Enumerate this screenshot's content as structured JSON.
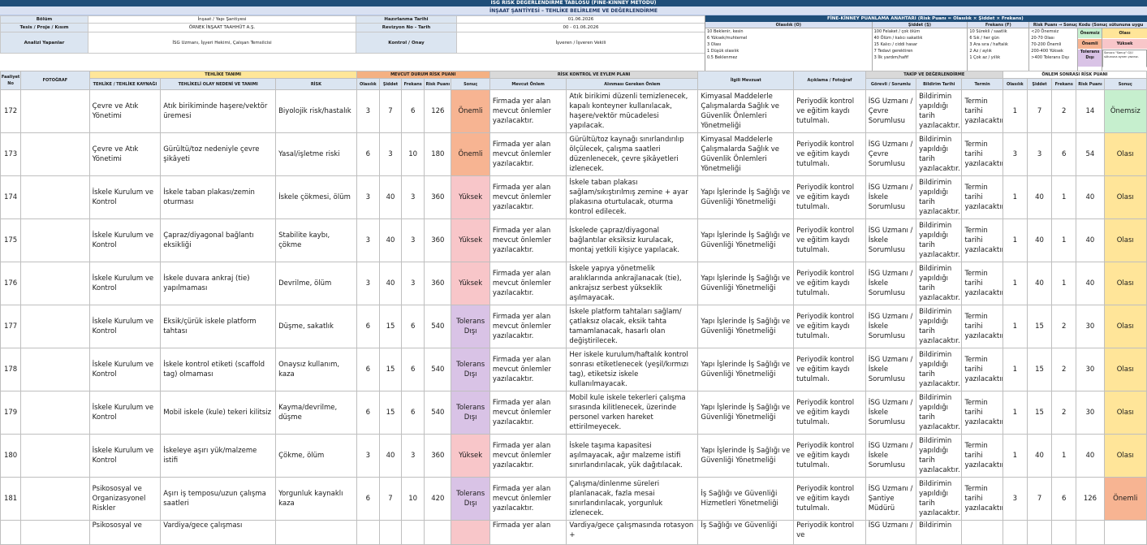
{
  "title": "İSG RİSK DEĞERLENDİRME TABLOSU (FİNE-KİNNEY METODU)",
  "subtitle": "İNŞAAT ŞANTİYESİ – TEHLİKE BELİRLEME VE DEĞERLENDİRME",
  "meta": {
    "bolum_label": "Bölüm",
    "bolum_value": "İnşaat / Yapı Şantiyesi",
    "tesis_label": "Tesis / Proje / Kısım",
    "tesis_value": "ÖRNEK İNŞAAT TAAHHÜT A.Ş.",
    "analiz_label": "Analizi Yapanlar",
    "analiz_value": "İSG Uzmanı, İşyeri Hekimi, Çalışan Temsilcisi",
    "hazirlanma_label": "Hazırlanma Tarihi",
    "hazirlanma_value": "01.06.2026",
    "revizyon_label": "Revizyon No - Tarih",
    "revizyon_value": "00 - 01.06.2026",
    "kontrol_label": "Kontrol / Onay",
    "kontrol_value": "İşveren / İşveren Vekili"
  },
  "legend": {
    "title": "FİNE-KİNNEY PUANLAMA ANAHTARI  (Risk Puanı = Olasılık × Şiddet × Frekans)",
    "h_olasilik": "Olasılık (O)",
    "h_siddet": "Şiddet (Ş)",
    "h_frekans": "Frekans (F)",
    "h_sonuc": "Risk Puanı → Sonuç Kodu (Sonuç sütununa uygu",
    "olasilik": [
      "10  Beklenir, kesin",
      "6  Yüksek/muhtemel",
      "3  Olası",
      "1  Düşük olasılık",
      "0.5  Beklenmez"
    ],
    "siddet": [
      "100  Felaket / çok ölüm",
      "40  Ölüm / kalıcı sakatlık",
      "15  Kalıcı / ciddi hasar",
      "7  Tedavi gerektiren",
      "3  İlk yardım/hafif"
    ],
    "frekans": [
      "10  Sürekli / saatlik",
      "6  Sık / her gün",
      "3  Ara sıra / haftalık",
      "2  Az / aylık",
      "1  Çok az / yıllık"
    ],
    "sonuc": [
      "<20  Önemsiz",
      "20-70  Olası",
      "70-200  Önemli",
      "200-400  Yüksek",
      ">400  Tolerans Dışı"
    ],
    "codes": [
      "Önemsiz",
      "Önemli",
      "Tolerans Dışı"
    ],
    "codes2": [
      "Olası",
      "Yüksek"
    ],
    "note": "Sonucu \"Sonuç\" G/U sütununa aynen yazınız."
  },
  "headers": {
    "g_faaliyet": "Faaliyet No",
    "g_foto": "FOTOĞRAF",
    "g_tanim": "TEHLİKE TANIMI",
    "g_mevcut": "MEVCUT DURUM RİSK PUANI",
    "g_kontrol": "RİSK KONTROL VE EYLEM PLANI",
    "g_takip": "TAKİP VE DEĞERLENDİRME",
    "g_sonra": "ÖNLEM SONRASI RİSK PUANI",
    "kaynak": "TEHLİKE / TEHLİKE KAYNAĞI",
    "olay": "TEHLİKELİ OLAY NEDENİ VE TANIMI",
    "risk": "RİSK",
    "olasilik": "Olasılık",
    "siddet": "Şiddet",
    "frekans": "Frekans",
    "puan": "Risk Puanı",
    "sonuc": "Sonuç",
    "mevcut_onlem": "Mevcut Önlem",
    "alinmasi": "Alınması Gereken Önlem",
    "mevzuat": "İlgili Mevzuat",
    "aciklama": "Açıklama / Fotoğraf",
    "gorevli": "Görevli / Sorumlu",
    "bildirim": "Bildirim Tarihi",
    "termin": "Termin",
    "olasilik2": "Olasılık",
    "siddet2": "Şiddet",
    "frekans2": "Frekans",
    "puan2": "Risk Puanı",
    "sonuc2": "Sonuç"
  },
  "rows": [
    {
      "no": "172",
      "kaynak": "Çevre ve Atık Yönetimi",
      "olay": "Atık birikiminde haşere/vektör üremesi",
      "risk": "Biyolojik risk/hastalık",
      "o": "3",
      "s": "7",
      "f": "6",
      "p": "126",
      "sonuc": "Önemli",
      "mevcut": "Firmada yer alan mevcut önlemler yazılacaktır.",
      "alinmasi": "Atık birikimi düzenli temizlenecek, kapalı konteyner kullanılacak, haşere/vektör mücadelesi yapılacak.",
      "mevzuat": "Kimyasal Maddelerle Çalışmalarda Sağlık ve Güvenlik Önlemleri Yönetmeliği",
      "aciklama": "Periyodik kontrol ve eğitim kaydı tutulmalı.",
      "gorevli": "İSG Uzmanı / Çevre Sorumlusu",
      "bildirim": "Bildirimin yapıldığı tarih yazılacaktır.",
      "termin": "Termin tarihi yazılacaktır.",
      "o2": "1",
      "s2": "7",
      "f2": "2",
      "p2": "14",
      "sonuc2": "Önemsiz"
    },
    {
      "no": "173",
      "kaynak": "Çevre ve Atık Yönetimi",
      "olay": "Gürültü/toz nedeniyle çevre şikâyeti",
      "risk": "Yasal/işletme riski",
      "o": "6",
      "s": "3",
      "f": "10",
      "p": "180",
      "sonuc": "Önemli",
      "mevcut": "Firmada yer alan mevcut önlemler yazılacaktır.",
      "alinmasi": "Gürültü/toz kaynağı sınırlandırılıp ölçülecek, çalışma saatleri düzenlenecek, çevre şikâyetleri izlenecek.",
      "mevzuat": "Kimyasal Maddelerle Çalışmalarda Sağlık ve Güvenlik Önlemleri Yönetmeliği",
      "aciklama": "Periyodik kontrol ve eğitim kaydı tutulmalı.",
      "gorevli": "İSG Uzmanı / Çevre Sorumlusu",
      "bildirim": "Bildirimin yapıldığı tarih yazılacaktır.",
      "termin": "Termin tarihi yazılacaktır.",
      "o2": "3",
      "s2": "3",
      "f2": "6",
      "p2": "54",
      "sonuc2": "Olası"
    },
    {
      "no": "174",
      "kaynak": "İskele Kurulum ve Kontrol",
      "olay": "İskele taban plakası/zemin oturması",
      "risk": "İskele çökmesi, ölüm",
      "o": "3",
      "s": "40",
      "f": "3",
      "p": "360",
      "sonuc": "Yüksek",
      "mevcut": "Firmada yer alan mevcut önlemler yazılacaktır.",
      "alinmasi": "İskele taban plakası sağlam/sıkıştırılmış zemine + ayar plakasına oturtulacak, oturma kontrol edilecek.",
      "mevzuat": "Yapı İşlerinde İş Sağlığı ve Güvenliği Yönetmeliği",
      "aciklama": "Periyodik kontrol ve eğitim kaydı tutulmalı.",
      "gorevli": "İSG Uzmanı / İskele Sorumlusu",
      "bildirim": "Bildirimin yapıldığı tarih yazılacaktır.",
      "termin": "Termin tarihi yazılacaktır.",
      "o2": "1",
      "s2": "40",
      "f2": "1",
      "p2": "40",
      "sonuc2": "Olası"
    },
    {
      "no": "175",
      "kaynak": "İskele Kurulum ve Kontrol",
      "olay": "Çapraz/diyagonal bağlantı eksikliği",
      "risk": "Stabilite kaybı, çökme",
      "o": "3",
      "s": "40",
      "f": "3",
      "p": "360",
      "sonuc": "Yüksek",
      "mevcut": "Firmada yer alan mevcut önlemler yazılacaktır.",
      "alinmasi": "İskelede çapraz/diyagonal bağlantılar eksiksiz kurulacak, montaj yetkili kişiyce yapılacak.",
      "mevzuat": "Yapı İşlerinde İş Sağlığı ve Güvenliği Yönetmeliği",
      "aciklama": "Periyodik kontrol ve eğitim kaydı tutulmalı.",
      "gorevli": "İSG Uzmanı / İskele Sorumlusu",
      "bildirim": "Bildirimin yapıldığı tarih yazılacaktır.",
      "termin": "Termin tarihi yazılacaktır.",
      "o2": "1",
      "s2": "40",
      "f2": "1",
      "p2": "40",
      "sonuc2": "Olası"
    },
    {
      "no": "176",
      "kaynak": "İskele Kurulum ve Kontrol",
      "olay": "İskele duvara ankraj (tie) yapılmaması",
      "risk": "Devrilme, ölüm",
      "o": "3",
      "s": "40",
      "f": "3",
      "p": "360",
      "sonuc": "Yüksek",
      "mevcut": "Firmada yer alan mevcut önlemler yazılacaktır.",
      "alinmasi": "İskele yapıya yönetmelik aralıklarında ankrajlanacak (tie), ankrajsız serbest yükseklik aşılmayacak.",
      "mevzuat": "Yapı İşlerinde İş Sağlığı ve Güvenliği Yönetmeliği",
      "aciklama": "Periyodik kontrol ve eğitim kaydı tutulmalı.",
      "gorevli": "İSG Uzmanı / İskele Sorumlusu",
      "bildirim": "Bildirimin yapıldığı tarih yazılacaktır.",
      "termin": "Termin tarihi yazılacaktır.",
      "o2": "1",
      "s2": "40",
      "f2": "1",
      "p2": "40",
      "sonuc2": "Olası"
    },
    {
      "no": "177",
      "kaynak": "İskele Kurulum ve Kontrol",
      "olay": "Eksik/çürük iskele platform tahtası",
      "risk": "Düşme, sakatlık",
      "o": "6",
      "s": "15",
      "f": "6",
      "p": "540",
      "sonuc": "Tolerans Dışı",
      "mevcut": "Firmada yer alan mevcut önlemler yazılacaktır.",
      "alinmasi": "İskele platform tahtaları sağlam/çatlaksız olacak, eksik tahta tamamlanacak, hasarlı olan değiştirilecek.",
      "mevzuat": "Yapı İşlerinde İş Sağlığı ve Güvenliği Yönetmeliği",
      "aciklama": "Periyodik kontrol ve eğitim kaydı tutulmalı.",
      "gorevli": "İSG Uzmanı / İskele Sorumlusu",
      "bildirim": "Bildirimin yapıldığı tarih yazılacaktır.",
      "termin": "Termin tarihi yazılacaktır.",
      "o2": "1",
      "s2": "15",
      "f2": "2",
      "p2": "30",
      "sonuc2": "Olası"
    },
    {
      "no": "178",
      "kaynak": "İskele Kurulum ve Kontrol",
      "olay": "İskele kontrol etiketi (scaffold tag) olmaması",
      "risk": "Onaysız kullanım, kaza",
      "o": "6",
      "s": "15",
      "f": "6",
      "p": "540",
      "sonuc": "Tolerans Dışı",
      "mevcut": "Firmada yer alan mevcut önlemler yazılacaktır.",
      "alinmasi": "Her iskele kurulum/haftalık kontrol sonrası etiketlenecek (yeşil/kırmızı tag), etiketsiz iskele kullanılmayacak.",
      "mevzuat": "Yapı İşlerinde İş Sağlığı ve Güvenliği Yönetmeliği",
      "aciklama": "Periyodik kontrol ve eğitim kaydı tutulmalı.",
      "gorevli": "İSG Uzmanı / İskele Sorumlusu",
      "bildirim": "Bildirimin yapıldığı tarih yazılacaktır.",
      "termin": "Termin tarihi yazılacaktır.",
      "o2": "1",
      "s2": "15",
      "f2": "2",
      "p2": "30",
      "sonuc2": "Olası"
    },
    {
      "no": "179",
      "kaynak": "İskele Kurulum ve Kontrol",
      "olay": "Mobil iskele (kule) tekeri kilitsiz",
      "risk": "Kayma/devrilme, düşme",
      "o": "6",
      "s": "15",
      "f": "6",
      "p": "540",
      "sonuc": "Tolerans Dışı",
      "mevcut": "Firmada yer alan mevcut önlemler yazılacaktır.",
      "alinmasi": "Mobil kule iskele tekerleri çalışma sırasında kilitlenecek, üzerinde personel varken hareket ettirilmeyecek.",
      "mevzuat": "Yapı İşlerinde İş Sağlığı ve Güvenliği Yönetmeliği",
      "aciklama": "Periyodik kontrol ve eğitim kaydı tutulmalı.",
      "gorevli": "İSG Uzmanı / İskele Sorumlusu",
      "bildirim": "Bildirimin yapıldığı tarih yazılacaktır.",
      "termin": "Termin tarihi yazılacaktır.",
      "o2": "1",
      "s2": "15",
      "f2": "2",
      "p2": "30",
      "sonuc2": "Olası"
    },
    {
      "no": "180",
      "kaynak": "İskele Kurulum ve Kontrol",
      "olay": "İskeleye aşırı yük/malzeme istifi",
      "risk": "Çökme, ölüm",
      "o": "3",
      "s": "40",
      "f": "3",
      "p": "360",
      "sonuc": "Yüksek",
      "mevcut": "Firmada yer alan mevcut önlemler yazılacaktır.",
      "alinmasi": "İskele taşıma kapasitesi aşılmayacak, ağır malzeme istifi sınırlandırılacak, yük dağıtılacak.",
      "mevzuat": "Yapı İşlerinde İş Sağlığı ve Güvenliği Yönetmeliği",
      "aciklama": "Periyodik kontrol ve eğitim kaydı tutulmalı.",
      "gorevli": "İSG Uzmanı / İskele Sorumlusu",
      "bildirim": "Bildirimin yapıldığı tarih yazılacaktır.",
      "termin": "Termin tarihi yazılacaktır.",
      "o2": "1",
      "s2": "40",
      "f2": "1",
      "p2": "40",
      "sonuc2": "Olası"
    },
    {
      "no": "181",
      "kaynak": "Psikososyal ve Organizasyonel Riskler",
      "olay": "Aşırı iş temposu/uzun çalışma saatleri",
      "risk": "Yorgunluk kaynaklı kaza",
      "o": "6",
      "s": "7",
      "f": "10",
      "p": "420",
      "sonuc": "Tolerans Dışı",
      "mevcut": "Firmada yer alan mevcut önlemler yazılacaktır.",
      "alinmasi": "Çalışma/dinlenme süreleri planlanacak, fazla mesai sınırlandırılacak, yorgunluk izlenecek.",
      "mevzuat": "İş Sağlığı ve Güvenliği Hizmetleri Yönetmeliği",
      "aciklama": "Periyodik kontrol ve eğitim kaydı tutulmalı.",
      "gorevli": "İSG Uzmanı / Şantiye Müdürü",
      "bildirim": "Bildirimin yapıldığı tarih yazılacaktır.",
      "termin": "Termin tarihi yazılacaktır.",
      "o2": "3",
      "s2": "7",
      "f2": "6",
      "p2": "126",
      "sonuc2": "Önemli"
    },
    {
      "no": "",
      "kaynak": "Psikososyal ve",
      "olay": "Vardiya/gece çalışması",
      "risk": "",
      "o": "",
      "s": "",
      "f": "",
      "p": "",
      "sonuc": "",
      "mevcut": "Firmada yer alan",
      "alinmasi": "Vardiya/gece çalışmasında rotasyon +",
      "mevzuat": "İş Sağlığı ve Güvenliği",
      "aciklama": "Periyodik kontrol ve",
      "gorevli": "İSG Uzmanı /",
      "bildirim": "Bildirimin",
      "termin": "",
      "o2": "",
      "s2": "",
      "f2": "",
      "p2": "",
      "sonuc2": ""
    }
  ]
}
